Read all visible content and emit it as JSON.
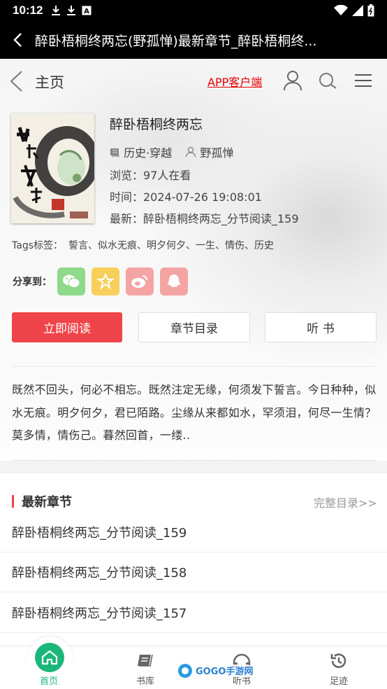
{
  "status_bar": {
    "time": "10:12",
    "icons": [
      "download-icon",
      "download-icon",
      "a-icon",
      "wifi-icon",
      "signal-icon",
      "battery-icon"
    ]
  },
  "app_bar": {
    "title": "醉卧梧桐终两忘(野孤惮)最新章节_醉卧梧桐终..."
  },
  "nav": {
    "home_label": "主页",
    "app_link": "APP客户端"
  },
  "book": {
    "title": "醉卧梧桐终两忘",
    "category": "历史·穿越",
    "author": "野孤惮",
    "views": "浏览：97人在看",
    "time": "时间：2024-07-26 19:08:01",
    "latest": "最新：醉卧梧桐终两忘_分节阅读_159",
    "tags_label": "Tags标签：",
    "tags": "誓言、似水无痕、明夕何夕、一生、情伤、历史"
  },
  "share": {
    "label": "分享到：",
    "targets": [
      "wechat-icon",
      "qzone-icon",
      "weibo-icon",
      "qq-icon"
    ]
  },
  "buttons": {
    "read": "立即阅读",
    "toc": "章节目录",
    "listen": "听 书"
  },
  "description": "既然不回头，何必不相忘。既然注定无缘，何须发下誓言。今日种种，似水无痕。明夕何夕，君已陌路。尘缘从来都如水，罕须泪，何尽一生情？莫多情，情伤己。暮然回首，一缕..",
  "latest_section": {
    "title": "最新章节",
    "more": "完整目录>>",
    "chapters": [
      "醉卧梧桐终两忘_分节阅读_159",
      "醉卧梧桐终两忘_分节阅读_158",
      "醉卧梧桐终两忘_分节阅读_157"
    ]
  },
  "bottom_nav": {
    "items": [
      {
        "label": "首页",
        "active": true
      },
      {
        "label": "书库",
        "active": false
      },
      {
        "label": "听书",
        "active": false
      },
      {
        "label": "足迹",
        "active": false
      }
    ],
    "watermark": "GOGO手游网",
    "active_color": "#1bb679"
  },
  "colors": {
    "accent": "#ef4449",
    "link": "#e60000"
  }
}
